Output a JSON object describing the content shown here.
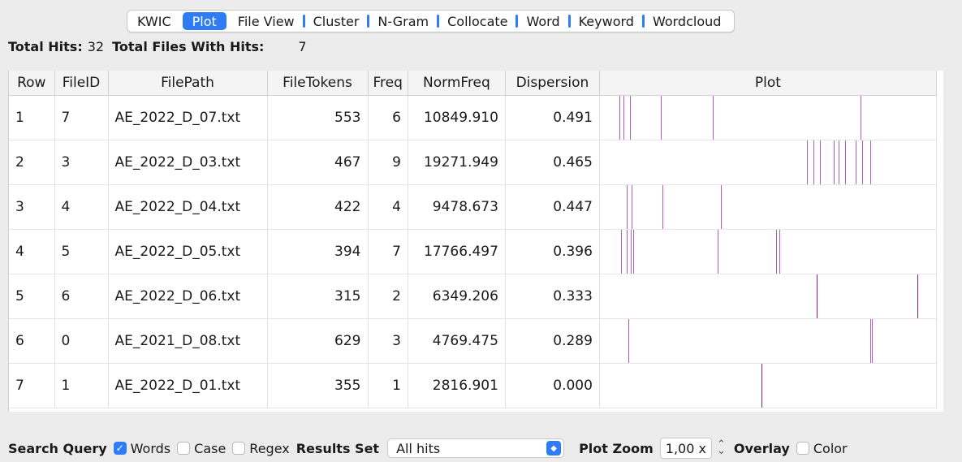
{
  "tabs": [
    {
      "label": "KWIC",
      "active": false
    },
    {
      "label": "Plot",
      "active": true
    },
    {
      "label": "File View",
      "active": false
    },
    {
      "label": "Cluster",
      "active": false
    },
    {
      "label": "N-Gram",
      "active": false
    },
    {
      "label": "Collocate",
      "active": false
    },
    {
      "label": "Word",
      "active": false
    },
    {
      "label": "Keyword",
      "active": false
    },
    {
      "label": "Wordcloud",
      "active": false
    }
  ],
  "stats": {
    "total_hits_label": "Total Hits:",
    "total_hits": "32",
    "total_files_label": "Total Files With Hits:",
    "total_files": "7"
  },
  "table": {
    "headers": [
      "Row",
      "FileID",
      "FilePath",
      "FileTokens",
      "Freq",
      "NormFreq",
      "Dispersion",
      "Plot"
    ],
    "rows": [
      {
        "row": "1",
        "fileid": "7",
        "filepath": "AE_2022_D_07.txt",
        "tokens": "553",
        "freq": "6",
        "normfreq": "10849.910",
        "dispersion": "0.491",
        "hits": [
          0.057,
          0.07,
          0.09,
          0.18,
          0.335,
          0.775
        ]
      },
      {
        "row": "2",
        "fileid": "3",
        "filepath": "AE_2022_D_03.txt",
        "tokens": "467",
        "freq": "9",
        "normfreq": "19271.949",
        "dispersion": "0.465",
        "hits": [
          0.615,
          0.635,
          0.655,
          0.695,
          0.71,
          0.73,
          0.76,
          0.78,
          0.805
        ]
      },
      {
        "row": "3",
        "fileid": "4",
        "filepath": "AE_2022_D_04.txt",
        "tokens": "422",
        "freq": "4",
        "normfreq": "9478.673",
        "dispersion": "0.447",
        "hits": [
          0.08,
          0.095,
          0.185,
          0.36
        ]
      },
      {
        "row": "4",
        "fileid": "5",
        "filepath": "AE_2022_D_05.txt",
        "tokens": "394",
        "freq": "7",
        "normfreq": "17766.497",
        "dispersion": "0.396",
        "hits": [
          0.062,
          0.08,
          0.092,
          0.1,
          0.35,
          0.525,
          0.535
        ]
      },
      {
        "row": "5",
        "fileid": "6",
        "filepath": "AE_2022_D_06.txt",
        "tokens": "315",
        "freq": "2",
        "normfreq": "6349.206",
        "dispersion": "0.333",
        "hits": [
          0.645,
          0.945
        ]
      },
      {
        "row": "6",
        "fileid": "0",
        "filepath": "AE_2021_D_08.txt",
        "tokens": "629",
        "freq": "3",
        "normfreq": "4769.475",
        "dispersion": "0.289",
        "hits": [
          0.085,
          0.805,
          0.81
        ]
      },
      {
        "row": "7",
        "fileid": "1",
        "filepath": "AE_2022_D_01.txt",
        "tokens": "355",
        "freq": "1",
        "normfreq": "2816.901",
        "dispersion": "0.000",
        "hits": [
          0.48
        ]
      }
    ]
  },
  "bottom": {
    "search_query_label": "Search Query",
    "words_label": "Words",
    "words_checked": true,
    "case_label": "Case",
    "case_checked": false,
    "regex_label": "Regex",
    "regex_checked": false,
    "results_set_label": "Results Set",
    "results_set_value": "All hits",
    "plot_zoom_label": "Plot Zoom",
    "plot_zoom_value": "1,00 x",
    "overlay_label": "Overlay",
    "color_label": "Color",
    "color_checked": false
  },
  "colors": {
    "accent": "#2f7cf6",
    "plot_line": "#b45cc0",
    "plot_line_dark": "#8a1f8a"
  }
}
